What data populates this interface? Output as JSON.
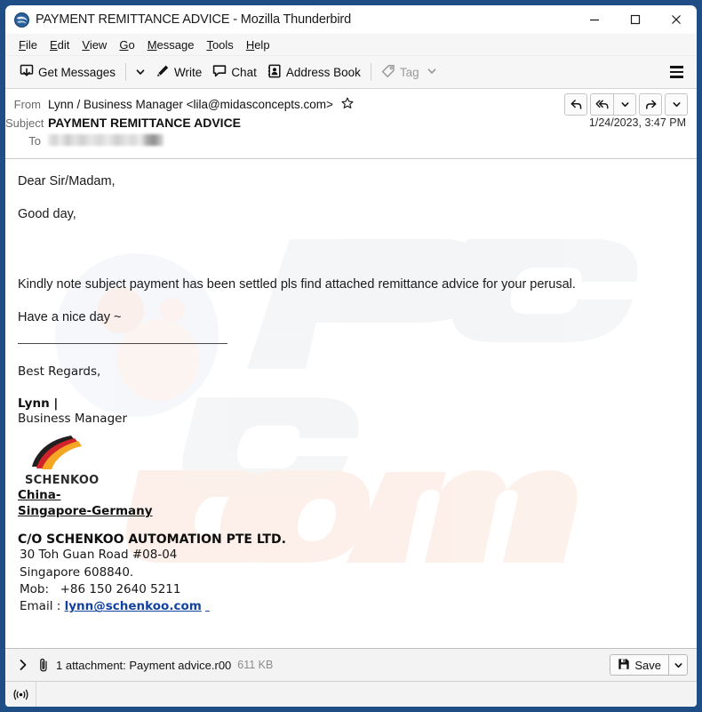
{
  "window": {
    "title": "PAYMENT REMITTANCE ADVICE - Mozilla Thunderbird",
    "app_icon": "thunderbird-icon",
    "controls": {
      "minimize": "minimize-icon",
      "maximize": "maximize-icon",
      "close": "close-icon"
    }
  },
  "menubar": {
    "items": [
      {
        "label": "File",
        "access": "F"
      },
      {
        "label": "Edit",
        "access": "E"
      },
      {
        "label": "View",
        "access": "V"
      },
      {
        "label": "Go",
        "access": "G"
      },
      {
        "label": "Message",
        "access": "M"
      },
      {
        "label": "Tools",
        "access": "T"
      },
      {
        "label": "Help",
        "access": "H"
      }
    ]
  },
  "toolbar": {
    "get_messages_label": "Get Messages",
    "get_messages_icon": "inbox-download-icon",
    "get_messages_caret": "chevron-down-icon",
    "write_label": "Write",
    "write_icon": "pencil-icon",
    "chat_label": "Chat",
    "chat_icon": "chat-bubble-icon",
    "address_book_label": "Address Book",
    "address_book_icon": "address-book-icon",
    "tag_label": "Tag",
    "tag_icon": "tag-icon",
    "tag_caret": "chevron-down-icon",
    "app_menu_icon": "hamburger-menu-icon"
  },
  "message_header": {
    "from_label": "From",
    "from_value": "Lynn / Business Manager <lila@midasconcepts.com>",
    "star_icon": "star-outline-icon",
    "subject_label": "Subject",
    "subject_value": "PAYMENT REMITTANCE ADVICE",
    "to_label": "To",
    "to_value_redacted": "",
    "date": "1/24/2023, 3:47 PM",
    "actions": {
      "reply": "reply-icon",
      "reply_all": "reply-all-icon",
      "reply_more": "chevron-down-icon",
      "forward": "forward-icon",
      "more": "chevron-down-icon"
    }
  },
  "message_body": {
    "greeting": "Dear Sir/Madam,",
    "salutation": "Good day,",
    "paragraph": "Kindly note subject payment has been settled pls find attached remittance advice for your perusal.",
    "closing_wish": "Have a nice day ~",
    "regards": "Best Regards,",
    "signer_name": "Lynn |",
    "signer_title": "Business Manager",
    "logo_alt": "schenkoo-logo",
    "logo_text": "SCHENKOO",
    "region_line1": "China-",
    "region_line2": "Singapore-Germany",
    "company": "C/O SCHENKOO AUTOMATION PTE LTD.",
    "address_line1": "30 Toh Guan Road  #08-04",
    "address_line2": "Singapore 608840.",
    "mobile_label": "Mob:",
    "mobile_value": "+86 150 2640 5211",
    "email_label": "Email :",
    "email_value": "lynn@schenkoo.com"
  },
  "watermark": {
    "text": "pcrisk.com"
  },
  "attachment_bar": {
    "expander_icon": "chevron-right-icon",
    "clip_icon": "paperclip-icon",
    "summary": "1 attachment: Payment advice.r00",
    "size": "611 KB",
    "save_label": "Save",
    "save_icon": "save-disk-icon",
    "save_caret": "chevron-down-icon"
  },
  "statusbar": {
    "connection_icon": "broadcast-icon"
  },
  "colors": {
    "window_border": "#1f4e86",
    "link": "#12439e",
    "toolbar_bg": "#f6f6f6",
    "logo_black": "#231f20",
    "logo_red": "#d1232a",
    "logo_yellow": "#f5a623"
  }
}
